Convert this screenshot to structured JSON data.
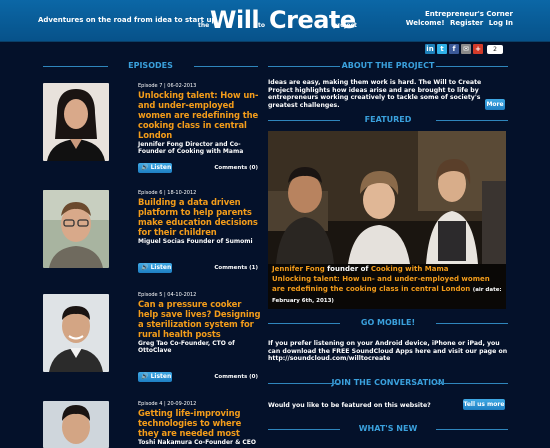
{
  "header": {
    "tagline": "Adventures on the road from idea to start up",
    "logo": {
      "the": "the",
      "will": "Will",
      "to": "to",
      "create": "Create",
      "project": "project"
    },
    "corner_title": "Entrepreneur's Corner",
    "links": [
      "Welcome!",
      "Register",
      "Log In"
    ]
  },
  "social": {
    "icons": [
      "linkedin-icon",
      "twitter-icon",
      "facebook-icon",
      "email-icon",
      "google-plus-icon"
    ],
    "count": "2"
  },
  "episodes": {
    "heading": "EPISODES",
    "items": [
      {
        "meta": "Episode 7 | 06-02-2013",
        "title": "Unlocking talent: How un- and under-employed women are redefining the cooking class in central London",
        "subtitle": "Jennifer Fong Director and Co-Founder of Cooking with Mama",
        "listen": "Listen",
        "comments": "Comments (0)"
      },
      {
        "meta": "Episode 6 | 18-10-2012",
        "title": "Building a data driven platform to help parents make education decisions for their children",
        "subtitle": "Miguel Socias Founder of Sumomi",
        "listen": "Listen",
        "comments": "Comments (1)"
      },
      {
        "meta": "Episode 5 | 04-10-2012",
        "title": "Can a pressure cooker help save lives? Designing a sterilization system for rural health posts",
        "subtitle": "Greg Tao Co-Founder, CTO of OttoClave",
        "listen": "Listen",
        "comments": "Comments (0)"
      },
      {
        "meta": "Episode 4 | 20-09-2012",
        "title": "Getting life-improving technologies to where they are needed most",
        "subtitle": "Toshi Nakamura Co-Founder & CEO",
        "listen": "",
        "comments": ""
      }
    ]
  },
  "about": {
    "heading": "ABOUT THE PROJECT",
    "text": "Ideas are easy, making them work is hard. The Will to Create Project highlights how ideas arise and are brought to life by entrepreneurs working creatively to tackle some of society's greatest challenges.",
    "more": "More"
  },
  "featured": {
    "heading": "FEATURED",
    "name": "Jennifer Fong",
    "founder_of": "founder of",
    "org": "Cooking with Mama",
    "title": "Unlocking talent: How un- and under-employed women are redefining the cooking class in central London",
    "air_date": "(air date: February 6th, 2013)"
  },
  "mobile": {
    "heading": "GO MOBILE!",
    "text": "If you prefer listening on your Android device, iPhone or iPad, you can download the FREE SoundCloud Apps here and visit our page on",
    "link": "http://soundcloud.com/willtocreate"
  },
  "conversation": {
    "heading": "JOIN THE CONVERSATION",
    "text": "Would you like to be featured on this website?",
    "button": "Tell us more"
  },
  "whatsnew": {
    "heading": "WHAT'S NEW"
  },
  "colors": {
    "accent": "#3aa0dc",
    "title_orange": "#f39c1a",
    "background": "#04112a",
    "header": "#0b67a6"
  }
}
